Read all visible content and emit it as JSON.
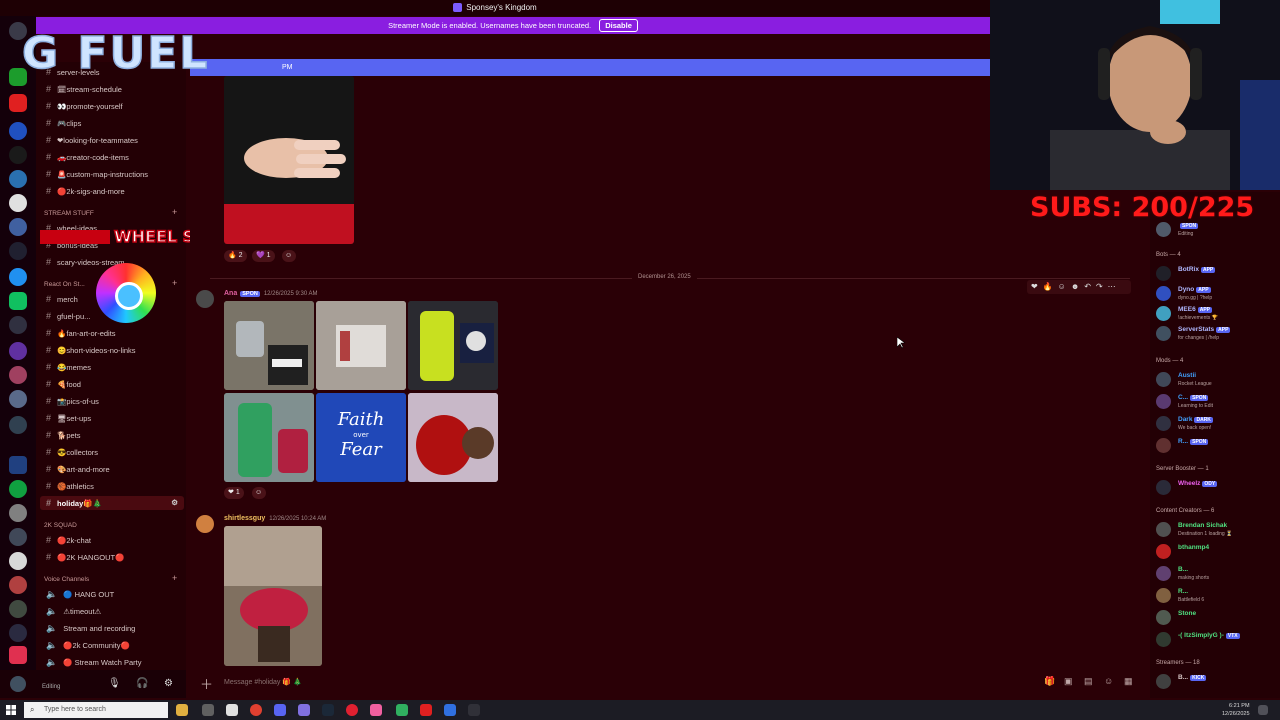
{
  "title_bar": {
    "server_name": "Sponsey's Kingdom"
  },
  "streamer_banner": {
    "text": "Streamer Mode is enabled. Usernames have been truncated.",
    "disable_label": "Disable"
  },
  "blue_banner": {
    "text": "PM"
  },
  "overlay": {
    "logo_text": "G FUEL",
    "wheel_text": "WHEEL SPIN!",
    "subs_text": "SUBS: 200/225"
  },
  "channels": {
    "items": [
      {
        "name": "server-levels"
      },
      {
        "name": "🗓stream-schedule"
      },
      {
        "name": "👀promote-yourself"
      },
      {
        "name": "🎮clips"
      },
      {
        "name": "❤looking-for-teammates"
      },
      {
        "name": "🚗creator-code-items"
      },
      {
        "name": "🚨custom-map-instructions"
      },
      {
        "name": "🔴2k-sigs-and-more"
      }
    ],
    "cat_stream": "STREAM STUFF",
    "stream_items": [
      {
        "name": "wheel-ideas"
      },
      {
        "name": "bonus-ideas"
      },
      {
        "name": "scary-videos-stream"
      }
    ],
    "cat_react": "React On St...",
    "react_items": [
      {
        "name": "merch"
      },
      {
        "name": "gfuel-pu..."
      },
      {
        "name": "🔥fan-art-or-edits"
      },
      {
        "name": "😊short-videos-no-links"
      },
      {
        "name": "😂memes"
      },
      {
        "name": "🍕food"
      },
      {
        "name": "📸pics-of-us"
      },
      {
        "name": "🖥set-ups"
      },
      {
        "name": "🐕pets"
      },
      {
        "name": "😎collectors"
      },
      {
        "name": "🎨art-and-more"
      },
      {
        "name": "🏀athletics"
      },
      {
        "name": "holiday🎁🎄"
      }
    ],
    "cat_squad": "2K SQUAD",
    "squad_items": [
      {
        "name": "🔴2k-chat"
      },
      {
        "name": "🔴2K HANGOUT🔴"
      }
    ],
    "cat_voice": "Voice Channels",
    "voice_items": [
      {
        "name": "🔵 HANG OUT"
      },
      {
        "name": "⚠timeout⚠"
      },
      {
        "name": "Stream and recording"
      },
      {
        "name": "🔴2k Community🔴"
      },
      {
        "name": "🔴 Stream Watch Party"
      }
    ]
  },
  "user_panel": {
    "status": "Editing"
  },
  "messages": {
    "reactions_top": [
      {
        "emoji": "🔥",
        "count": "2"
      },
      {
        "emoji": "💜",
        "count": "1"
      }
    ],
    "date_divider": "December 26, 2025",
    "msg1": {
      "author": "Ana",
      "tag": "SPON",
      "timestamp": "12/26/2025 9:30 AM",
      "reaction_count": "1",
      "poster_text_1": "Faith",
      "poster_text_2": "over",
      "poster_text_3": "Fear"
    },
    "msg2": {
      "author": "shirtlessguy",
      "timestamp": "12/26/2025 10:24 AM"
    }
  },
  "composer": {
    "placeholder": "Message #holiday 🎁 🎄"
  },
  "members": {
    "top": {
      "name": "SPON",
      "status": "Editing"
    },
    "bots_header": "Bots — 4",
    "bots": [
      {
        "name": "BotRix",
        "tag": "APP",
        "status": ""
      },
      {
        "name": "Dyno",
        "tag": "APP",
        "status": "dyno.gg | ?help"
      },
      {
        "name": "MEE6",
        "tag": "APP",
        "status": "!achievements 🏆"
      },
      {
        "name": "ServerStats",
        "tag": "APP",
        "status": "for changes | /help"
      }
    ],
    "mods_header": "Mods — 4",
    "mods": [
      {
        "name": "Austii",
        "status": "Rocket League"
      },
      {
        "name": "C...",
        "tag": "SPON",
        "status": "Learning to Edit"
      },
      {
        "name": "Dark",
        "tag": "DARK",
        "status": "We back open!"
      },
      {
        "name": "R...",
        "tag": "SPON",
        "status": ""
      }
    ],
    "booster_header": "Server Booster — 1",
    "boosters": [
      {
        "name": "Wheelz",
        "tag": "ODY",
        "status": ""
      }
    ],
    "creators_header": "Content Creators — 6",
    "creators": [
      {
        "name": "Brendan Sichak",
        "status": "Destination 1 loading ⏳"
      },
      {
        "name": "bthanmp4",
        "status": ""
      },
      {
        "name": "B...",
        "status": "making shorts"
      },
      {
        "name": "R...",
        "status": "Battlefield 6"
      },
      {
        "name": "Stone",
        "status": ""
      },
      {
        "name": "-( ItzSimplyG )-",
        "tag": "VTX",
        "status": ""
      }
    ],
    "streamers_header": "Streamers — 18",
    "streamers": [
      {
        "name": "B...",
        "tag": "KICK",
        "status": ""
      }
    ]
  },
  "taskbar": {
    "search_placeholder": "Type here to search",
    "time": "6:21 PM",
    "date": "12/26/2025"
  }
}
